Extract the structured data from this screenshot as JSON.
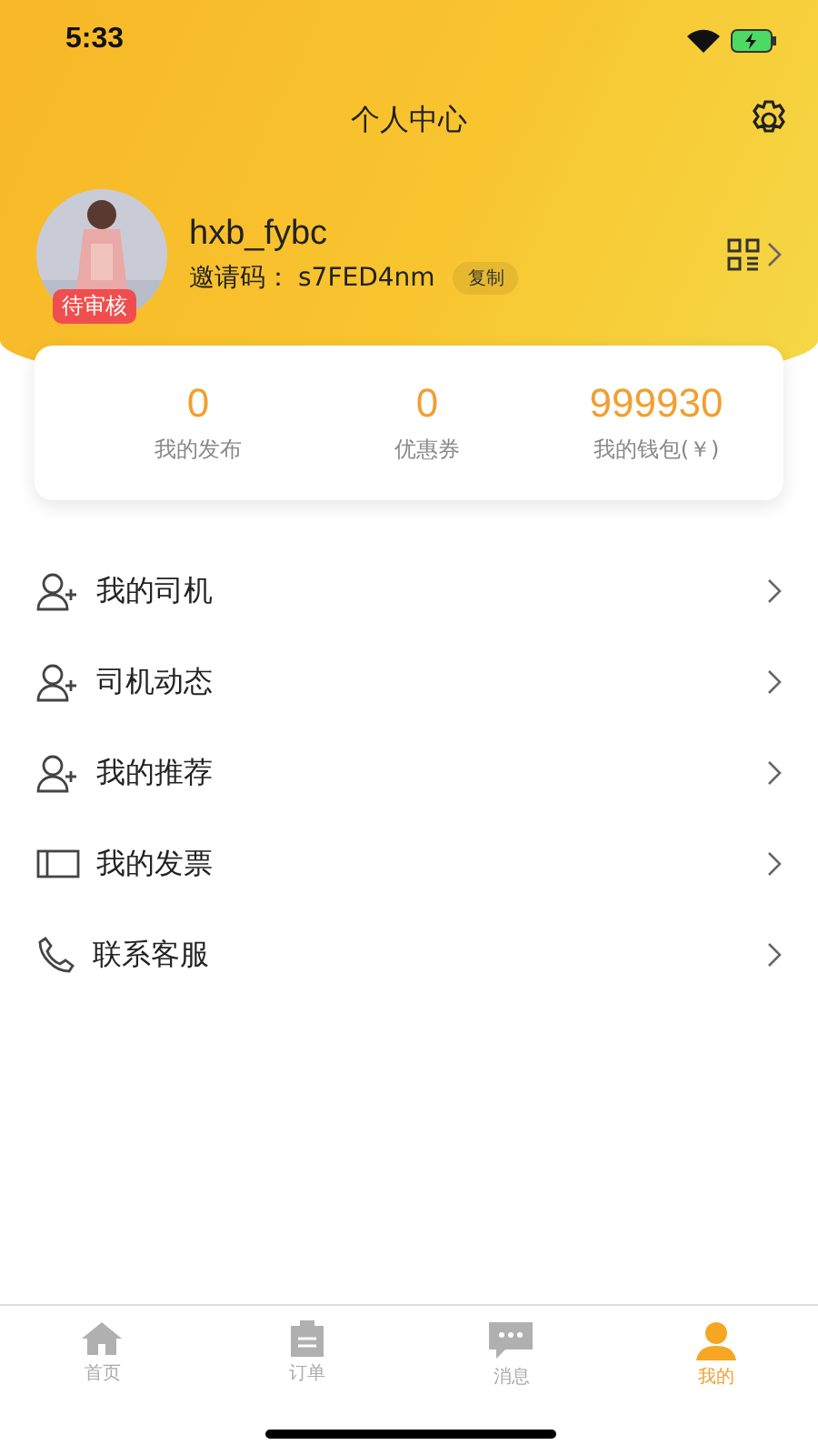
{
  "status_bar": {
    "time": "5:33"
  },
  "header": {
    "title": "个人中心"
  },
  "profile": {
    "badge": "待审核",
    "username": "hxb_fybc",
    "invite_label": "邀请码：",
    "invite_code": "s7FED4nm",
    "copy_button": "复制"
  },
  "stats": [
    {
      "value": "0",
      "label": "我的发布"
    },
    {
      "value": "0",
      "label": "优惠券"
    },
    {
      "value": "999930",
      "label": "我的钱包(￥)"
    }
  ],
  "menu": [
    {
      "kind": "person",
      "label": "我的司机"
    },
    {
      "kind": "person",
      "label": "司机动态"
    },
    {
      "kind": "person",
      "label": "我的推荐"
    },
    {
      "kind": "invoice",
      "label": "我的发票"
    },
    {
      "kind": "phone",
      "label": "联系客服"
    }
  ],
  "tabs": [
    {
      "kind": "home",
      "label": "首页",
      "selected": false
    },
    {
      "kind": "orders",
      "label": "订单",
      "selected": false
    },
    {
      "kind": "messages",
      "label": "消息",
      "selected": false
    },
    {
      "kind": "me",
      "label": "我的",
      "selected": true
    }
  ]
}
